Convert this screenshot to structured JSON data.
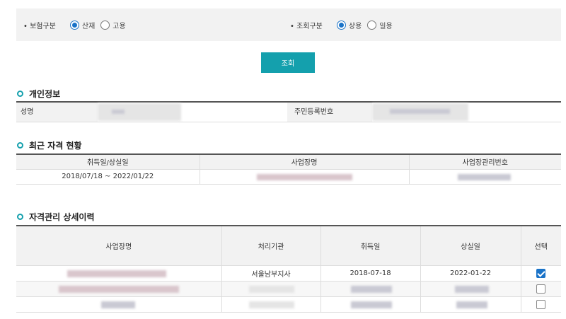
{
  "filters": {
    "insurance_type": {
      "label": "보험구분",
      "options": [
        {
          "label": "산재",
          "selected": true
        },
        {
          "label": "고용",
          "selected": false
        }
      ]
    },
    "query_type": {
      "label": "조회구분",
      "options": [
        {
          "label": "상용",
          "selected": true
        },
        {
          "label": "일용",
          "selected": false
        }
      ]
    }
  },
  "search_button": "조회",
  "personal_info": {
    "title": "개인정보",
    "name_label": "성명",
    "rrn_label": "주민등록번호"
  },
  "recent_status": {
    "title": "최근 자격 현황",
    "columns": [
      "취득일/상실일",
      "사업장명",
      "사업장관리번호"
    ],
    "rows": [
      {
        "dates": "2018/07/18 ~ 2022/01/22"
      }
    ]
  },
  "history": {
    "title": "자격관리 상세이력",
    "columns": [
      "사업장명",
      "처리기관",
      "취득일",
      "상실일",
      "선택"
    ],
    "rows": [
      {
        "agency": "서울남부지사",
        "acquired": "2018-07-18",
        "lost": "2022-01-22",
        "checked": true
      },
      {
        "agency": "",
        "acquired": "",
        "lost": "",
        "checked": false
      },
      {
        "agency": "",
        "acquired": "",
        "lost": "",
        "checked": false
      }
    ]
  },
  "colors": {
    "accent": "#14a0ad",
    "radio_blue": "#1a73c8"
  }
}
